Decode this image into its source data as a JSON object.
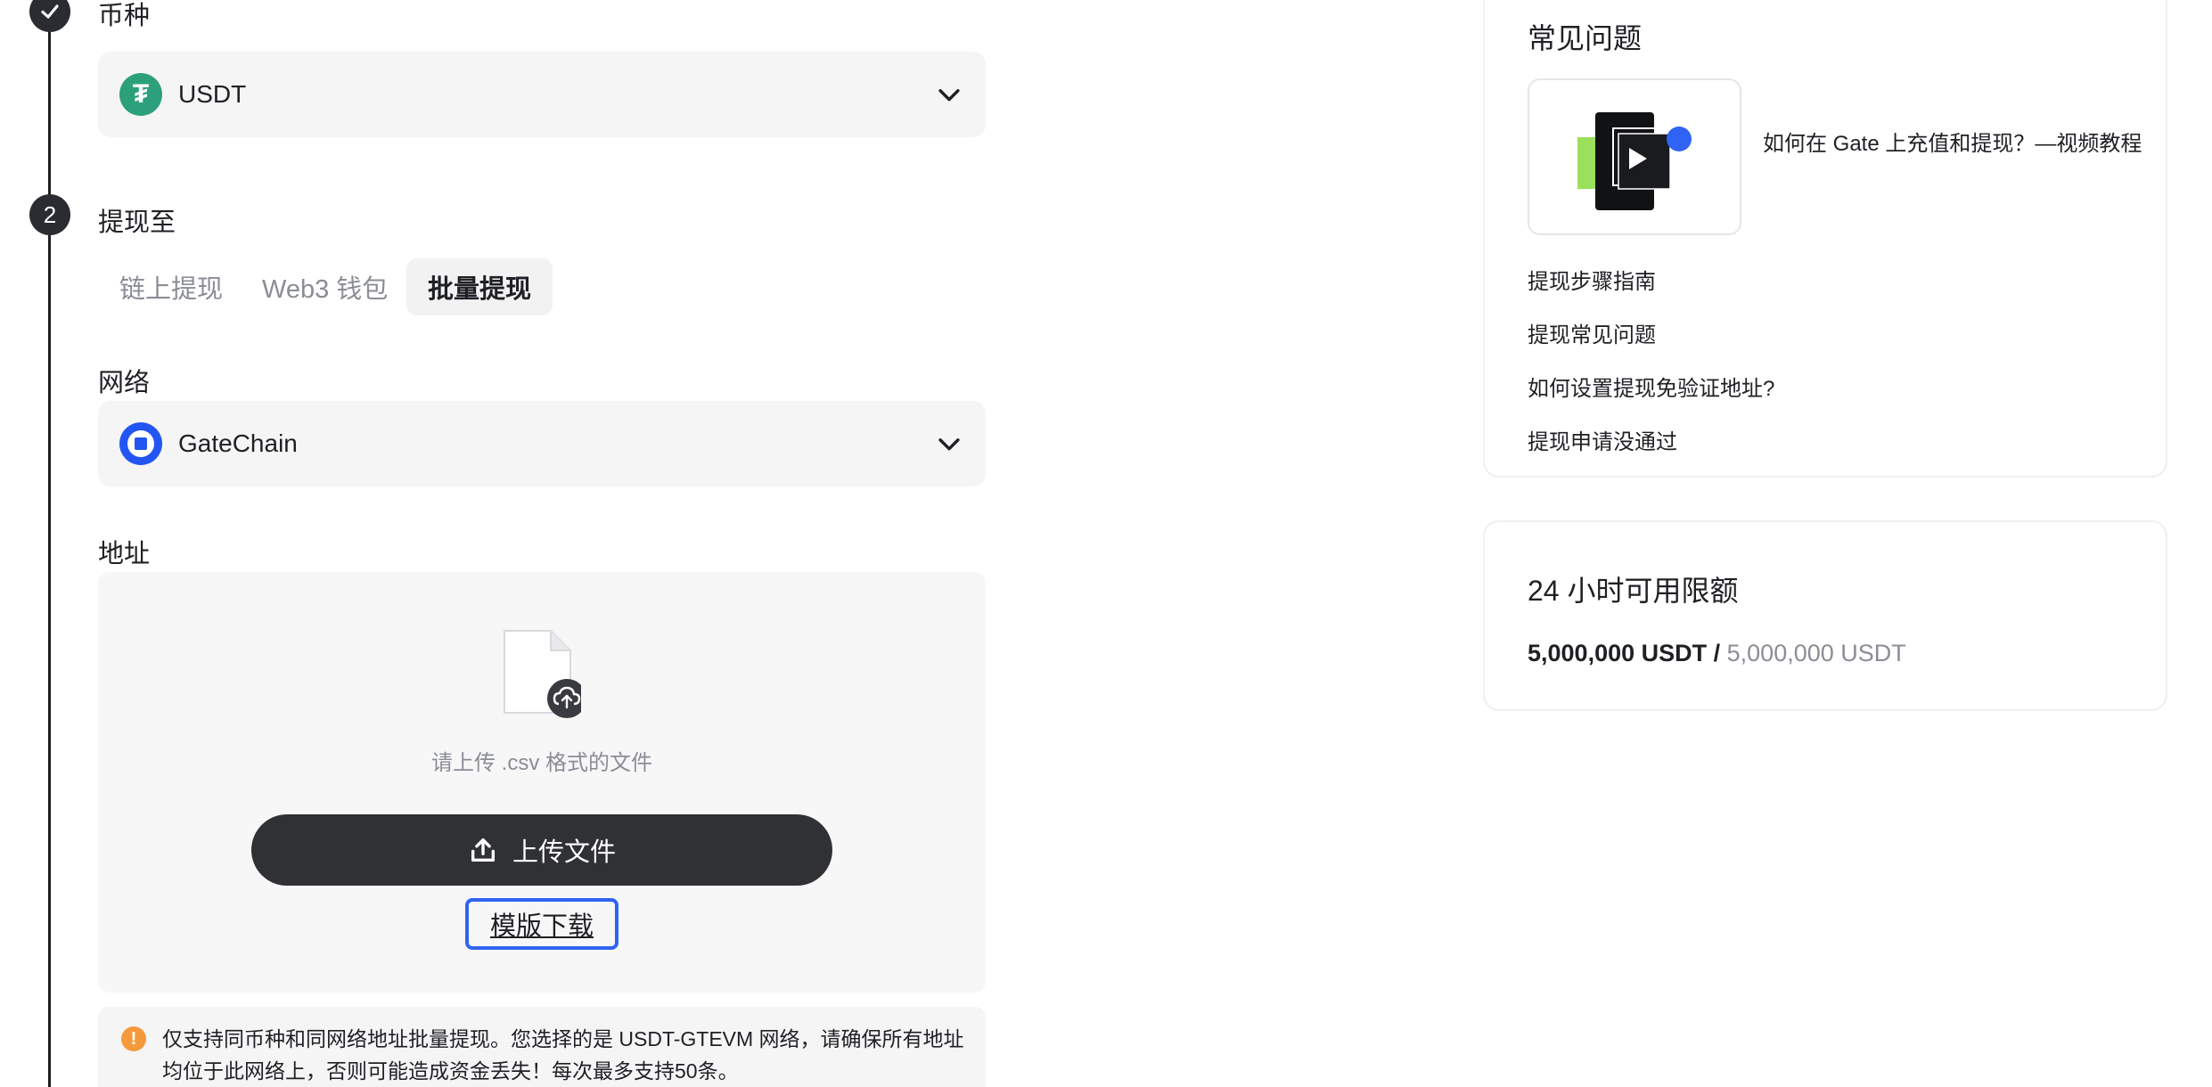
{
  "steps": {
    "step1": {
      "title": "币种"
    },
    "step2": {
      "number": "2",
      "title": "提现至"
    }
  },
  "currency": {
    "symbol_glyph": "₮",
    "name": "USDT",
    "icon_color": "#2ca07a"
  },
  "tabs": [
    {
      "label": "链上提现",
      "active": false
    },
    {
      "label": "Web3 钱包",
      "active": false
    },
    {
      "label": "批量提现",
      "active": true
    }
  ],
  "network": {
    "label": "网络",
    "name": "GateChain",
    "icon_color": "#2355f2"
  },
  "address": {
    "label": "地址",
    "upload_hint": "请上传 .csv 格式的文件",
    "upload_button": "上传文件",
    "template_link": "模版下载"
  },
  "warning": {
    "text": "仅支持同币种和同网络地址批量提现。您选择的是 USDT-GTEVM 网络，请确保所有地址均位于此网络上，否则可能造成资金丢失！每次最多支持50条。"
  },
  "faq": {
    "title": "常见问题",
    "video_title": "如何在 Gate 上充值和提现？—视频教程",
    "links": [
      "提现步骤指南",
      "提现常见问题",
      "如何设置提现免验证地址?",
      "提现申请没通过"
    ]
  },
  "limit": {
    "title": "24 小时可用限额",
    "used": "5,000,000 USDT /",
    "total": "5,000,000 USDT"
  },
  "colors": {
    "accent_blue": "#2f63f3",
    "dark": "#303135",
    "warning": "#f59a3b"
  }
}
